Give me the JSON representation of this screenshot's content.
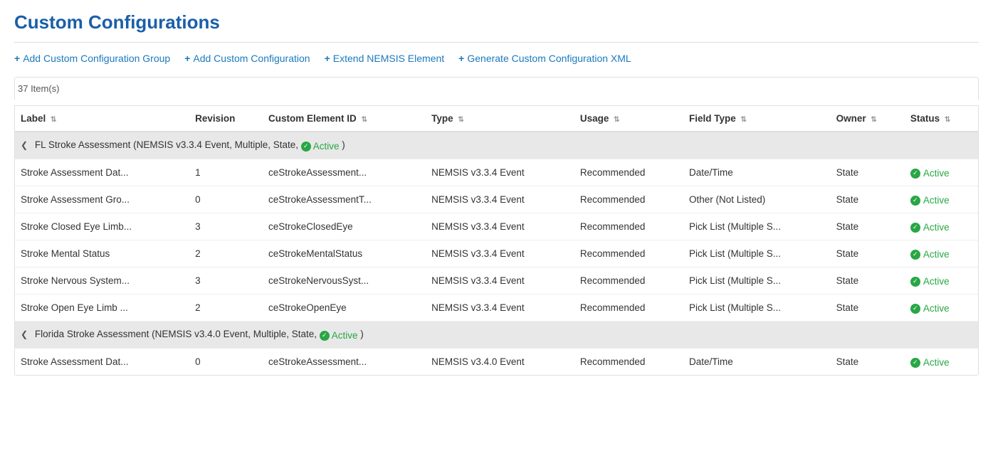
{
  "page": {
    "title": "Custom Configurations"
  },
  "toolbar": {
    "links": [
      {
        "id": "add-group",
        "label": "Add Custom Configuration Group"
      },
      {
        "id": "add-config",
        "label": "Add Custom Configuration"
      },
      {
        "id": "extend-nemsis",
        "label": "Extend NEMSIS Element"
      },
      {
        "id": "generate-xml",
        "label": "Generate Custom Configuration XML"
      }
    ]
  },
  "table": {
    "item_count": "37 Item(s)",
    "columns": [
      {
        "id": "label",
        "label": "Label",
        "sortable": true
      },
      {
        "id": "revision",
        "label": "Revision",
        "sortable": false
      },
      {
        "id": "custom-element-id",
        "label": "Custom Element ID",
        "sortable": true
      },
      {
        "id": "type",
        "label": "Type",
        "sortable": true
      },
      {
        "id": "usage",
        "label": "Usage",
        "sortable": true
      },
      {
        "id": "field-type",
        "label": "Field Type",
        "sortable": true
      },
      {
        "id": "owner",
        "label": "Owner",
        "sortable": true
      },
      {
        "id": "status",
        "label": "Status",
        "sortable": true
      }
    ],
    "groups": [
      {
        "id": "group-1",
        "label": "FL Stroke Assessment (NEMSIS v3.3.4 Event, Multiple, State,",
        "status": "Active",
        "rows": [
          {
            "label": "Stroke Assessment Dat...",
            "revision": "1",
            "element_id": "ceStrokeAssessment...",
            "type": "NEMSIS v3.3.4 Event",
            "usage": "Recommended",
            "field_type": "Date/Time",
            "owner": "State",
            "status": "Active"
          },
          {
            "label": "Stroke Assessment Gro...",
            "revision": "0",
            "element_id": "ceStrokeAssessmentT...",
            "type": "NEMSIS v3.3.4 Event",
            "usage": "Recommended",
            "field_type": "Other (Not Listed)",
            "owner": "State",
            "status": "Active"
          },
          {
            "label": "Stroke Closed Eye Limb...",
            "revision": "3",
            "element_id": "ceStrokeClosedEye",
            "type": "NEMSIS v3.3.4 Event",
            "usage": "Recommended",
            "field_type": "Pick List (Multiple S...",
            "owner": "State",
            "status": "Active"
          },
          {
            "label": "Stroke Mental Status",
            "revision": "2",
            "element_id": "ceStrokeMentalStatus",
            "type": "NEMSIS v3.3.4 Event",
            "usage": "Recommended",
            "field_type": "Pick List (Multiple S...",
            "owner": "State",
            "status": "Active"
          },
          {
            "label": "Stroke Nervous System...",
            "revision": "3",
            "element_id": "ceStrokeNervousSyst...",
            "type": "NEMSIS v3.3.4 Event",
            "usage": "Recommended",
            "field_type": "Pick List (Multiple S...",
            "owner": "State",
            "status": "Active"
          },
          {
            "label": "Stroke Open Eye Limb ...",
            "revision": "2",
            "element_id": "ceStrokeOpenEye",
            "type": "NEMSIS v3.3.4 Event",
            "usage": "Recommended",
            "field_type": "Pick List (Multiple S...",
            "owner": "State",
            "status": "Active"
          }
        ]
      },
      {
        "id": "group-2",
        "label": "Florida Stroke Assessment (NEMSIS v3.4.0 Event, Multiple, State,",
        "status": "Active",
        "rows": [
          {
            "label": "Stroke Assessment Dat...",
            "revision": "0",
            "element_id": "ceStrokeAssessment...",
            "type": "NEMSIS v3.4.0 Event",
            "usage": "Recommended",
            "field_type": "Date/Time",
            "owner": "State",
            "status": "Active"
          }
        ]
      }
    ]
  }
}
